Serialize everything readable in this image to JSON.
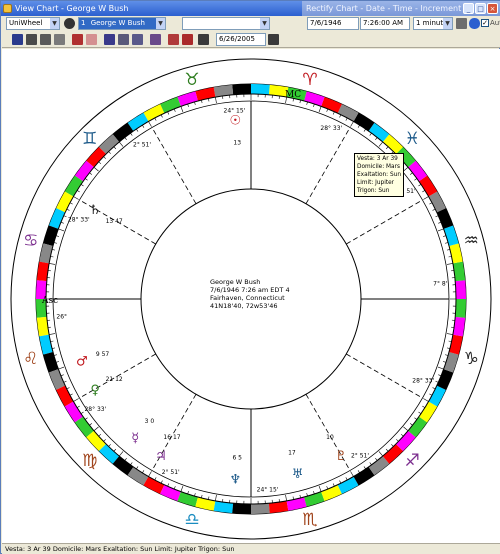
{
  "window": {
    "title": "View Chart - George W Bush",
    "rectify_title": "Rectify Chart - Date - Time - Increment",
    "buttons": [
      "_",
      "□",
      "×"
    ]
  },
  "toolbar": {
    "wheel_type": "UniWheel",
    "chart_number": "1",
    "chart_name": "George W Bush",
    "second_chart": "",
    "date": "6/26/2005"
  },
  "rectify": {
    "date": "7/6/1946",
    "time": "7:26:00 AM",
    "increment": "1 minute",
    "auto_label": "Auto",
    "auto_checked": true
  },
  "center": {
    "name": "George W Bush",
    "line1": "7/6/1946  7:26 am  EDT 4",
    "line2": "Fairhaven, Connecticut",
    "line3": "41N18'40,  72w53'46"
  },
  "tooltip": {
    "lines": [
      "Vesta: 3 Ar 39",
      "Domicile: Mars",
      "Exaltation: Sun",
      "Limit: Jupiter",
      "Trigon: Sun"
    ]
  },
  "status": {
    "text": "Vesta: 3 Ar 39  Domicile: Mars  Exaltation: Sun  Limit: Jupiter  Trigon: Sun"
  },
  "signs": [
    {
      "glyph": "♋",
      "color": "#7b2d8e"
    },
    {
      "glyph": "♊",
      "color": "#1d5a8a"
    },
    {
      "glyph": "♉",
      "color": "#2e7d1f"
    },
    {
      "glyph": "♈",
      "color": "#c0161c"
    },
    {
      "glyph": "♓",
      "color": "#1d5a8a"
    },
    {
      "glyph": "♒",
      "color": "#222222"
    },
    {
      "glyph": "♑",
      "color": "#222222"
    },
    {
      "glyph": "♐",
      "color": "#7b2d8e"
    },
    {
      "glyph": "♏",
      "color": "#a0441c"
    },
    {
      "glyph": "♎",
      "color": "#1a8cc0"
    },
    {
      "glyph": "♍",
      "color": "#a0441c"
    },
    {
      "glyph": "♌",
      "color": "#a0441c"
    }
  ],
  "axis_labels": {
    "asc": "Asc",
    "mc": "MC"
  },
  "house_cusps": [
    {
      "deg": "26°",
      "min": "",
      "pos": "asc"
    },
    {
      "deg": "24°",
      "min": "15'",
      "pos": "mc"
    },
    {
      "deg": "2°",
      "min": "51'",
      "pos": "h11"
    },
    {
      "deg": "28°",
      "min": "33'",
      "pos": "h12"
    },
    {
      "deg": "7°",
      "min": "8'",
      "pos": "desc"
    },
    {
      "deg": "2°",
      "min": "51'",
      "pos": "h5"
    },
    {
      "deg": "28°",
      "min": "33'",
      "pos": "h6"
    },
    {
      "deg": "24°",
      "min": "15'",
      "pos": "ic"
    },
    {
      "deg": "28°",
      "min": "33'",
      "pos": "h3"
    },
    {
      "deg": "2°",
      "min": "51'",
      "pos": "h2"
    },
    {
      "deg": "28°",
      "min": "33'",
      "pos": "h9"
    },
    {
      "deg": "2°",
      "min": "51'",
      "pos": "h8"
    }
  ],
  "planets": [
    {
      "glyph": "♀",
      "deg": "21",
      "min": "12",
      "color": "#2e7d1f"
    },
    {
      "glyph": "☿",
      "deg": "3",
      "min": "0",
      "color": "#7b2d8e"
    },
    {
      "glyph": "♄",
      "deg": "13",
      "min": "47",
      "color": "#222222"
    },
    {
      "glyph": "♂",
      "deg": "9",
      "min": "57",
      "color": "#c0161c"
    },
    {
      "glyph": "♃",
      "deg": "16",
      "min": "17",
      "color": "#7b2d8e"
    },
    {
      "glyph": "♆",
      "deg": "6",
      "min": "5",
      "color": "#1d5a8a"
    },
    {
      "glyph": "♅",
      "deg": "17",
      "min": "",
      "color": "#1d5a8a"
    },
    {
      "glyph": "♇",
      "deg": "10",
      "min": "",
      "color": "#a0441c"
    },
    {
      "glyph": "☉",
      "deg": "13",
      "min": "",
      "color": "#c0161c"
    }
  ],
  "colors": {
    "ring": [
      "#ff00ff",
      "#33cc33",
      "#ffff00",
      "#00ccff",
      "#000000",
      "#888888",
      "#ff0000"
    ],
    "cusp_label_red": "#cc2222"
  }
}
